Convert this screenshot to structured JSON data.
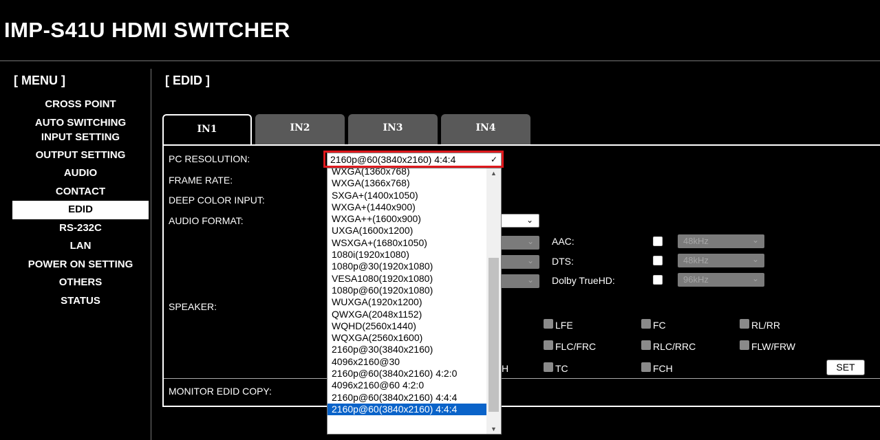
{
  "app_title": "IMP-S41U HDMI SWITCHER",
  "menu": {
    "heading": "[ MENU ]",
    "items": [
      {
        "label": "CROSS POINT"
      },
      {
        "label": "AUTO SWITCHING"
      },
      {
        "label": "INPUT SETTING"
      },
      {
        "label": "OUTPUT SETTING"
      },
      {
        "label": "AUDIO"
      },
      {
        "label": "CONTACT"
      },
      {
        "label": "EDID"
      },
      {
        "label": "RS-232C"
      },
      {
        "label": "LAN"
      },
      {
        "label": "POWER ON SETTING"
      },
      {
        "label": "OTHERS"
      },
      {
        "label": "STATUS"
      }
    ],
    "active": "EDID"
  },
  "section_heading": "[ EDID ]",
  "tabs": [
    {
      "label": "IN1"
    },
    {
      "label": "IN2"
    },
    {
      "label": "IN3"
    },
    {
      "label": "IN4"
    }
  ],
  "active_tab": "IN1",
  "form": {
    "pc_resolution_label": "PC RESOLUTION:",
    "frame_rate_label": "FRAME RATE:",
    "deep_color_label": "DEEP COLOR INPUT:",
    "audio_format_label": "AUDIO FORMAT:",
    "speaker_label": "SPEAKER:",
    "monitor_copy_label": "MONITOR EDID COPY:",
    "pc_resolution_value": "2160p@60(3840x2160) 4:4:4"
  },
  "resolution_options": [
    "WXGA(1360x768)",
    "WXGA(1366x768)",
    "SXGA+(1400x1050)",
    "WXGA+(1440x900)",
    "WXGA++(1600x900)",
    "UXGA(1600x1200)",
    "WSXGA+(1680x1050)",
    "1080i(1920x1080)",
    "1080p@30(1920x1080)",
    "VESA1080(1920x1080)",
    "1080p@60(1920x1080)",
    "WUXGA(1920x1200)",
    "QWXGA(2048x1152)",
    "WQHD(2560x1440)",
    "WQXGA(2560x1600)",
    "2160p@30(3840x2160)",
    "4096x2160@30",
    "2160p@60(3840x2160) 4:2:0",
    "4096x2160@60 4:2:0",
    "2160p@60(3840x2160) 4:4:4"
  ],
  "audio": {
    "aac_label": "AAC:",
    "aac_rate": "48kHz",
    "dts_label": "DTS:",
    "dts_rate": "48kHz",
    "dolby_label": "Dolby TrueHD:",
    "dolby_rate": "96kHz"
  },
  "speakers": {
    "lfe": "LFE",
    "fc": "FC",
    "rl_rr": "RL/RR",
    "flc_frc": "FLC/FRC",
    "rlc_rrc": "RLC/RRC",
    "flw_frw": "FLW/FRW",
    "tc": "TC",
    "fch": "FCH",
    "partial_h": "H"
  },
  "set_button": "SET",
  "icons": {
    "select_arrow": "chevron-down-icon",
    "scroll_up": "triangle-up-icon",
    "scroll_down": "triangle-down-icon"
  },
  "colors": {
    "highlight_border": "#e0191d",
    "selected_option": "#0a63c9"
  }
}
